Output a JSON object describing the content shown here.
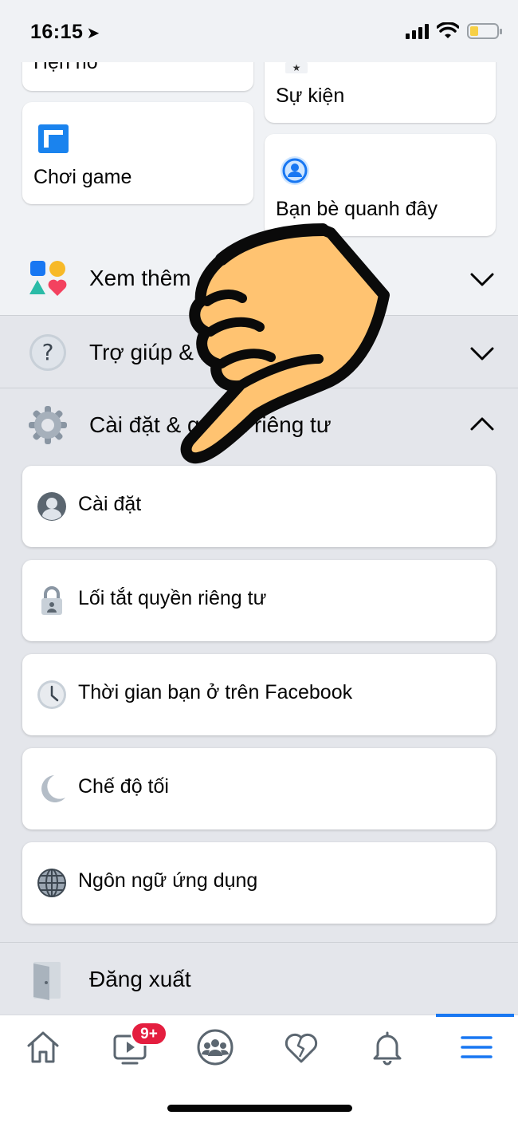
{
  "status": {
    "time": "16:15"
  },
  "shortcuts": {
    "dating_partial": "Hẹn hò",
    "events": "Sự kiện",
    "gaming": "Chơi game",
    "nearby_friends": "Bạn bè quanh đây"
  },
  "sections": {
    "see_more": "Xem thêm",
    "help": "Trợ giúp & hỗ trợ",
    "settings_privacy": "Cài đặt & quyền riêng tư"
  },
  "settings_items": [
    {
      "label": "Cài đặt",
      "icon": "account-circle-icon"
    },
    {
      "label": "Lối tắt quyền riêng tư",
      "icon": "lock-icon"
    },
    {
      "label": "Thời gian bạn ở trên Facebook",
      "icon": "clock-icon"
    },
    {
      "label": "Chế độ tối",
      "icon": "moon-icon"
    },
    {
      "label": "Ngôn ngữ ứng dụng",
      "icon": "globe-icon"
    }
  ],
  "logout": "Đăng xuất",
  "tabbar": {
    "watch_badge": "9+",
    "tabs": [
      "home",
      "watch",
      "groups",
      "dating",
      "notifications",
      "menu"
    ],
    "active": "menu"
  },
  "colors": {
    "accent": "#1877f2",
    "badge": "#e41e3f",
    "hand": "#ffc371"
  }
}
